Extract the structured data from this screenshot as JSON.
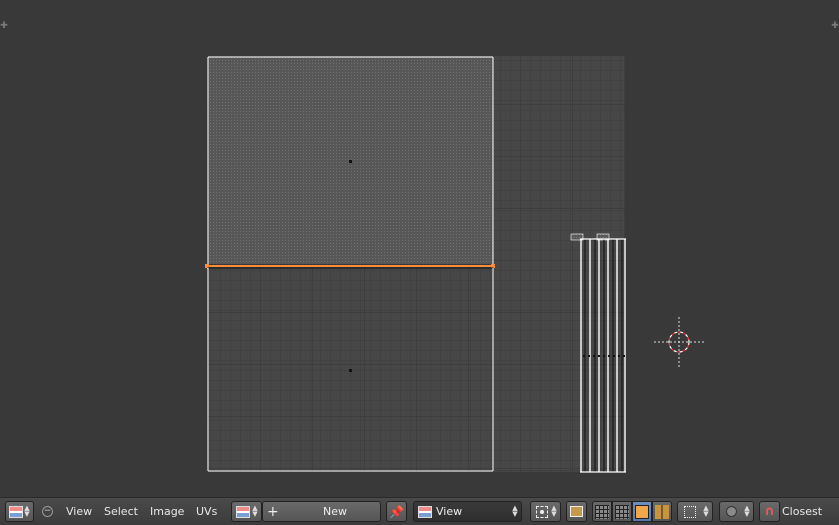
{
  "viewport": {
    "name": "uv-image-editor",
    "icons": {
      "top_left_corner": "plus-corner-icon",
      "top_right_corner": "plus-corner-icon",
      "cursor": "2d-cursor-icon"
    }
  },
  "header": {
    "editor_type_icon": "image-editor-icon",
    "collapse_icon": "collapse-menu-icon",
    "menus": {
      "view": "View",
      "select": "Select",
      "image": "Image",
      "uvs": "UVs"
    },
    "image_browse_icon": "image-browse-icon",
    "new_button_label": "New",
    "pin_icon": "pin-icon",
    "mode_icon": "image-icon",
    "mode_label": "View",
    "pivot_icon": "pivot-icon",
    "sync_icon": "sync-selection-icon",
    "select_modes": [
      "vertex-select-icon",
      "edge-select-icon",
      "face-select-icon",
      "island-select-icon"
    ],
    "sticky_icon": "sticky-selection-icon",
    "proportional_icon": "proportional-edit-icon",
    "snap_icon": "magnet-icon",
    "snap_target_label": "Closest"
  },
  "colors": {
    "background": "#393939",
    "uv_grid_dark": "#444444",
    "uv_grid_light": "#4f4f4f",
    "uv_edge": "#ffffff",
    "selected_edge": "#ff8c3a",
    "active_button": "#5679ad"
  }
}
